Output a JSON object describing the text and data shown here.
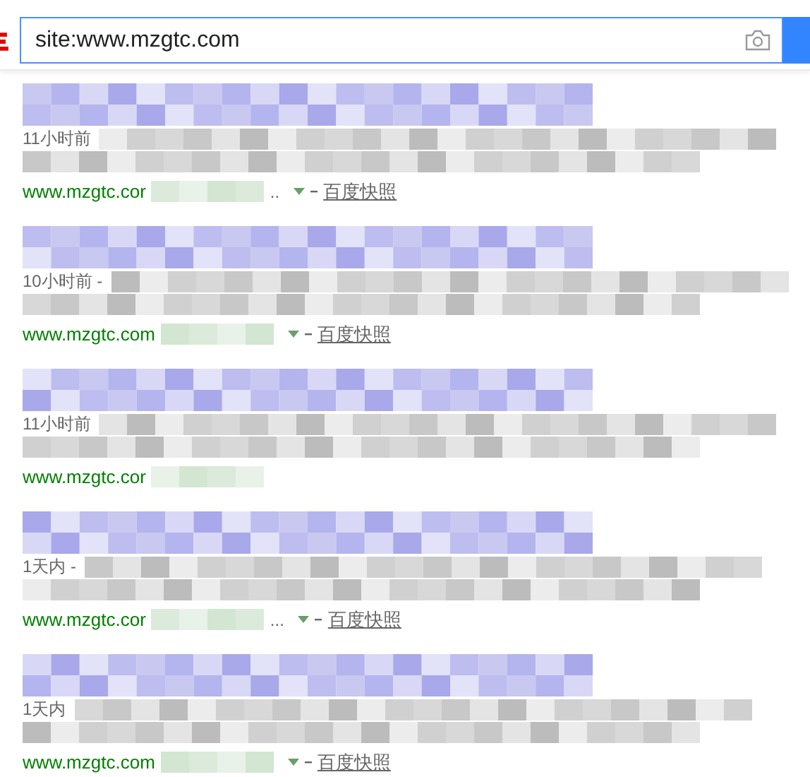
{
  "search": {
    "value": "site:www.mzgtc.com"
  },
  "results": [
    {
      "time": "11小时前",
      "url": "www.mzgtc.cor",
      "more": "..",
      "snapshot": "百度快照"
    },
    {
      "time": "10小时前 -",
      "url": "www.mzgtc.com",
      "snapshot": "百度快照"
    },
    {
      "time": "11小时前",
      "url": "www.mzgtc.cor"
    },
    {
      "time": "1天内 -",
      "url": "www.mzgtc.cor",
      "more": "...",
      "snapshot": "百度快照"
    },
    {
      "time": "1天内",
      "url": "www.mzgtc.com",
      "snapshot": "百度快照"
    }
  ]
}
